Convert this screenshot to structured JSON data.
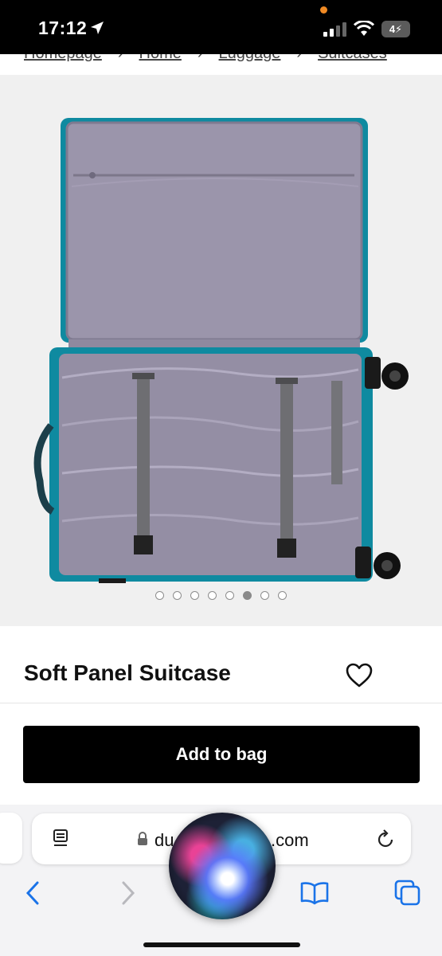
{
  "status_bar": {
    "time": "17:12",
    "battery": "4",
    "icons": [
      "location-arrow-icon",
      "cellular-signal-icon",
      "wifi-icon",
      "battery-icon"
    ]
  },
  "breadcrumb": {
    "items": [
      "Homepage",
      "Home",
      "Luggage",
      "Suitcases"
    ],
    "separator": "›"
  },
  "gallery": {
    "image_alt": "Open teal soft panel suitcase with grey lining",
    "total_slides": 8,
    "active_slide": 6,
    "lining_color": "#9b95ab",
    "shell_color": "#0f8aa0"
  },
  "product": {
    "title": "Soft Panel Suitcase"
  },
  "actions": {
    "add_to_bag": "Add to bag"
  },
  "browser": {
    "url_start": "du",
    "url_end": ".com",
    "icons": [
      "reader-icon",
      "lock-icon",
      "reload-icon",
      "back-icon",
      "forward-icon",
      "bookmarks-icon",
      "tabs-icon",
      "siri-icon"
    ]
  }
}
